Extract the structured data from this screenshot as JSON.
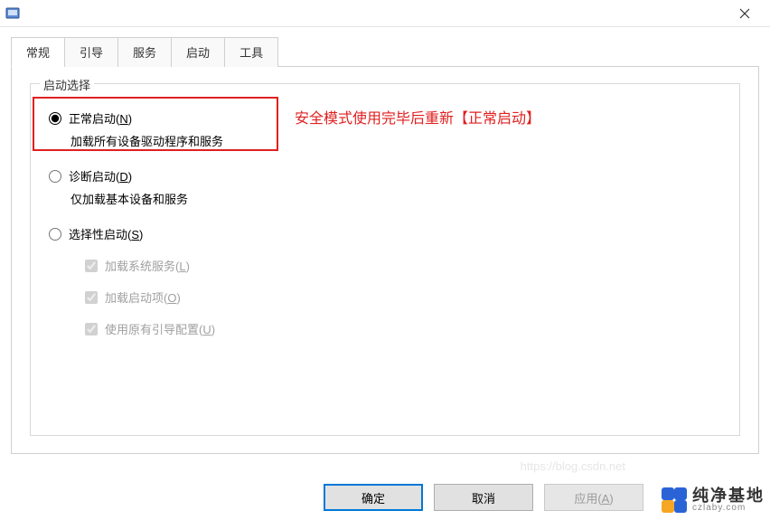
{
  "titlebar": {
    "close_tooltip": "Close"
  },
  "tabs": {
    "general": "常规",
    "boot": "引导",
    "services": "服务",
    "startup": "启动",
    "tools": "工具"
  },
  "fieldset_legend": "启动选择",
  "radio_normal": {
    "label_pre": "正常启动(",
    "mnemonic": "N",
    "label_post": ")",
    "desc": "加载所有设备驱动程序和服务"
  },
  "radio_diag": {
    "label_pre": "诊断启动(",
    "mnemonic": "D",
    "label_post": ")",
    "desc": "仅加载基本设备和服务"
  },
  "radio_sel": {
    "label_pre": "选择性启动(",
    "mnemonic": "S",
    "label_post": ")"
  },
  "chk_sys": {
    "label_pre": "加载系统服务(",
    "mnemonic": "L",
    "label_post": ")"
  },
  "chk_start": {
    "label_pre": "加载启动项(",
    "mnemonic": "O",
    "label_post": ")"
  },
  "chk_boot": {
    "label_pre": "使用原有引导配置(",
    "mnemonic": "U",
    "label_post": ")"
  },
  "annotation": "安全模式使用完毕后重新【正常启动】",
  "buttons": {
    "ok": "确定",
    "cancel": "取消",
    "apply_pre": "应用(",
    "apply_mn": "A",
    "apply_post": ")"
  },
  "watermark": "https://blog.csdn.net",
  "logo": {
    "cn": "纯净基地",
    "en": "czlaby.com"
  }
}
